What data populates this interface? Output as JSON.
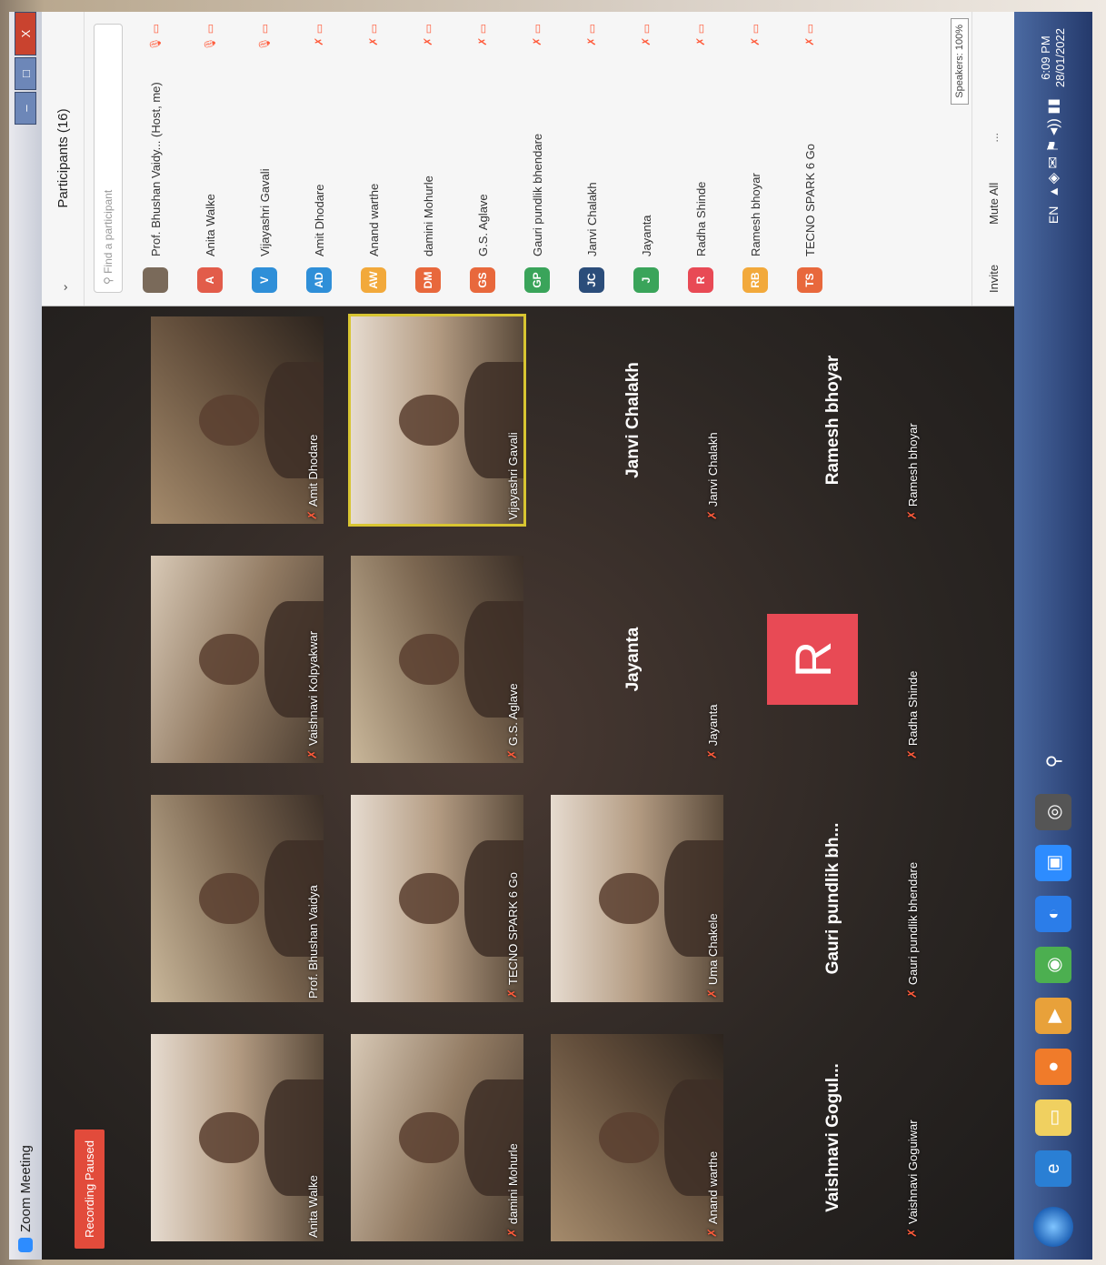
{
  "window": {
    "title": "Zoom Meeting",
    "controls": [
      "–",
      "□",
      "X"
    ]
  },
  "recording_badge": "Recording Paused",
  "tiles_row1": [
    {
      "name": "Anita Walke",
      "variant": "p3"
    },
    {
      "name": "Prof. Bhushan Vaidya",
      "variant": "p1"
    },
    {
      "name": "Vaishnavi Kolpyakwar",
      "variant": "p2"
    },
    {
      "name": "Amit Dhodare",
      "variant": "p4"
    }
  ],
  "tiles_row2": [
    {
      "name": "damini Mohurle",
      "variant": "p2"
    },
    {
      "name": "TECNO SPARK 6 Go",
      "variant": "p3"
    },
    {
      "name": "G.S. Aglave",
      "variant": "p1"
    },
    {
      "name": "Vijayashri Gavali",
      "variant": "p3"
    }
  ],
  "tiles_row3": [
    {
      "name": "Anand warthe",
      "big": ""
    },
    {
      "name": "Uma Chakele",
      "big": ""
    },
    {
      "name": "Jayanta",
      "big": "Jayanta"
    },
    {
      "name": "Janvi Chalakh",
      "big": "Janvi Chalakh"
    }
  ],
  "tiles_row4": [
    {
      "name": "Vaishnavi Goguiwar",
      "big": "Vaishnavi Gogul..."
    },
    {
      "name": "Gauri pundlik bhendare",
      "big": "Gauri pundlik bh..."
    },
    {
      "name": "Radha Shinde",
      "avatar": "R"
    },
    {
      "name": "Ramesh bhoyar",
      "big": "Ramesh bhoyar"
    }
  ],
  "panel": {
    "title": "Participants (16)",
    "search_placeholder": "Find a participant",
    "participants": [
      {
        "initials": "",
        "name": "Prof. Bhushan Vaidy... (Host, me)",
        "color": "#7a6a5a",
        "photo": true
      },
      {
        "initials": "A",
        "name": "Anita Walke",
        "color": "#e25c4a"
      },
      {
        "initials": "V",
        "name": "Vijayashri Gavali",
        "color": "#2f8fd8"
      },
      {
        "initials": "AD",
        "name": "Amit Dhodare",
        "color": "#2f8fd8"
      },
      {
        "initials": "AW",
        "name": "Anand warthe",
        "color": "#f2a93b"
      },
      {
        "initials": "DM",
        "name": "damini Mohurle",
        "color": "#e8683c"
      },
      {
        "initials": "GS",
        "name": "G.S. Aglave",
        "color": "#e8683c"
      },
      {
        "initials": "GP",
        "name": "Gauri pundlik bhendare",
        "color": "#3aa45a"
      },
      {
        "initials": "JC",
        "name": "Janvi Chalakh",
        "color": "#2b4d7a"
      },
      {
        "initials": "J",
        "name": "Jayanta",
        "color": "#3aa45a"
      },
      {
        "initials": "R",
        "name": "Radha Shinde",
        "color": "#e84a55"
      },
      {
        "initials": "RB",
        "name": "Ramesh bhoyar",
        "color": "#f2a93b"
      },
      {
        "initials": "TS",
        "name": "TECNO SPARK 6 Go",
        "color": "#e8683c"
      }
    ],
    "footer": {
      "invite": "Invite",
      "mute_all": "Mute All",
      "more": "..."
    },
    "speakers": "Speakers: 100%"
  },
  "taskbar": {
    "lang": "EN",
    "time": "6:09 PM",
    "date": "28/01/2022"
  }
}
